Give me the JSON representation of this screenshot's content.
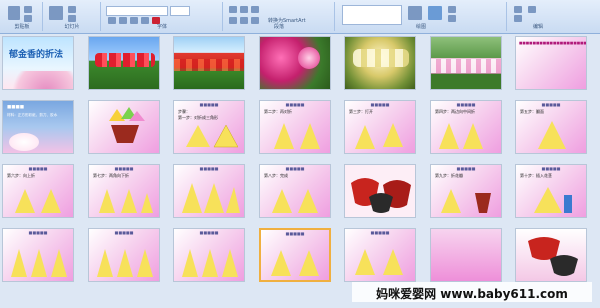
{
  "ribbon": {
    "groups": [
      {
        "label": "剪贴板"
      },
      {
        "label": "幻灯片"
      },
      {
        "label": "字体"
      },
      {
        "label": "段落"
      },
      {
        "label": "绘图"
      },
      {
        "label": "编辑"
      }
    ],
    "textbox_hint": "转换为SmartArt"
  },
  "slides": [
    {
      "title": "郁金香的折法"
    },
    {
      "caption": "材料：正方形彩纸、剪刀、胶水"
    },
    {
      "step": "步骤："
    },
    {
      "step": "第一步：对折成三角形"
    },
    {
      "step": "第二步：再对折"
    },
    {
      "step": "第三步：打开"
    },
    {
      "step": "第四步：两边向中间折"
    },
    {
      "step": "第五步：翻面"
    },
    {
      "step": "第六步：向上折"
    },
    {
      "step": "第七步：两角向下折"
    },
    {
      "step": "第八步：完成"
    },
    {
      "step": "第九步：折花瓣"
    },
    {
      "step": "第十步：插入花茎"
    }
  ],
  "watermark": {
    "text": "妈咪爱婴网 www.baby611.com"
  }
}
